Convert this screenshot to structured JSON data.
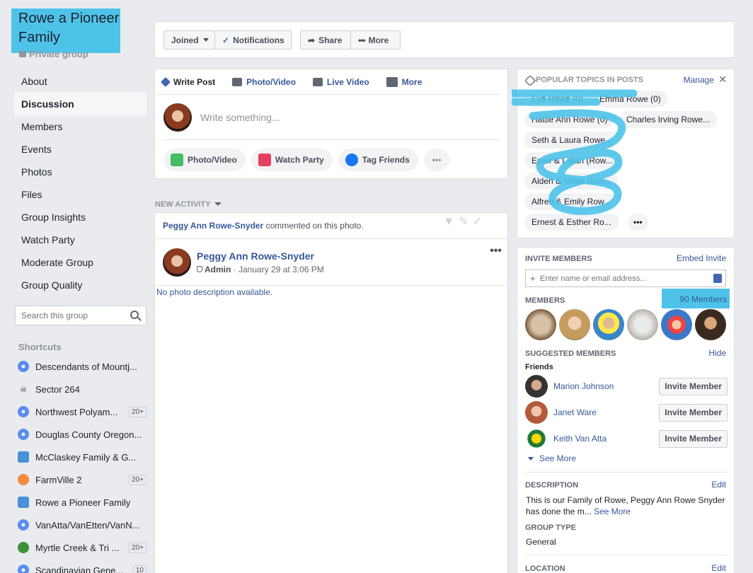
{
  "group": {
    "name_line1": "Rowe a Pioneer",
    "name_line2": "Family",
    "privacy": "Private group"
  },
  "nav": [
    {
      "label": "About"
    },
    {
      "label": "Discussion",
      "active": true
    },
    {
      "label": "Members"
    },
    {
      "label": "Events"
    },
    {
      "label": "Photos"
    },
    {
      "label": "Files"
    },
    {
      "label": "Group Insights"
    },
    {
      "label": "Watch Party"
    },
    {
      "label": "Moderate Group"
    },
    {
      "label": "Group Quality"
    }
  ],
  "search": {
    "placeholder": "Search this group"
  },
  "shortcuts": {
    "heading": "Shortcuts",
    "items": [
      {
        "label": "Descendants of Mountj...",
        "icon": "group-icon",
        "badge": ""
      },
      {
        "label": "Sector 264",
        "icon": "skull-icon",
        "badge": ""
      },
      {
        "label": "Northwest Polyam...",
        "icon": "group-icon",
        "badge": "20+"
      },
      {
        "label": "Douglas County Oregon...",
        "icon": "group-icon",
        "badge": ""
      },
      {
        "label": "McClaskey Family & G...",
        "icon": "shield-icon",
        "badge": ""
      },
      {
        "label": "FarmVille 2",
        "icon": "farmville-icon",
        "badge": "20+"
      },
      {
        "label": "Rowe a Pioneer Family",
        "icon": "shield-icon",
        "badge": ""
      },
      {
        "label": "VanAtta/VanEtten/VanN...",
        "icon": "group-icon",
        "badge": ""
      },
      {
        "label": "Myrtle Creek & Tri ...",
        "icon": "tree-icon",
        "badge": "20+"
      },
      {
        "label": "Scandinavian Gene...",
        "icon": "group-icon",
        "badge": "10"
      }
    ]
  },
  "actions": {
    "joined": "Joined",
    "notifications": "Notifications",
    "share": "Share",
    "more": "More"
  },
  "composer": {
    "tabs": [
      "Write Post",
      "Photo/Video",
      "Live Video",
      "More"
    ],
    "placeholder": "Write something...",
    "pills": [
      "Photo/Video",
      "Watch Party",
      "Tag Friends"
    ],
    "more_pill": "•••"
  },
  "feed": {
    "new_activity": "NEW ACTIVITY",
    "activity_actor": "Peggy Ann Rowe-Snyder",
    "activity_text": " commented on this photo.",
    "post_author": "Peggy Ann Rowe-Snyder",
    "post_role": "Admin",
    "post_time": " · January 29 at 3:06 PM",
    "post_menu": "•••",
    "no_desc": "No photo description available."
  },
  "topics": {
    "heading": "POPULAR TOPICS IN POSTS",
    "manage": "Manage",
    "close": "✕",
    "items": [
      "Eva Rowe (0)",
      "Emma Rowe (0)",
      "Hattie Ann Rowe (0)",
      "Charles Irving Rowe...",
      "Seth & Laura Rowe...",
      "Emer & Lillian (Row...",
      "Alden & Vesta Row...",
      "Alfred & Emily Row...",
      "Ernest & Esther Ro...",
      "•••"
    ]
  },
  "members_panel": {
    "invite_heading": "INVITE MEMBERS",
    "embed_invite": "Embed Invite",
    "invite_placeholder": "Enter name or email address...",
    "members_heading": "MEMBERS",
    "members_count": "90 Members",
    "suggested_heading": "SUGGESTED MEMBERS",
    "hide": "Hide",
    "friends_label": "Friends",
    "suggested": [
      {
        "name": "Marion Johnson",
        "button": "Invite Member"
      },
      {
        "name": "Janet Ware",
        "button": "Invite Member"
      },
      {
        "name": "Keith Van Atta",
        "button": "Invite Member"
      }
    ],
    "see_more": "See More",
    "description_heading": "DESCRIPTION",
    "description_edit": "Edit",
    "description_text": "This is our Family of Rowe, Peggy Ann Rowe Snyder has done the m...",
    "description_see_more": "See More",
    "group_type_heading": "GROUP TYPE",
    "group_type": "General",
    "location_heading": "LOCATION",
    "location_edit": "Edit"
  },
  "colors": {
    "highlight": "#4ec3ea",
    "link": "#365899",
    "facebook_blue": "#4267b2"
  }
}
